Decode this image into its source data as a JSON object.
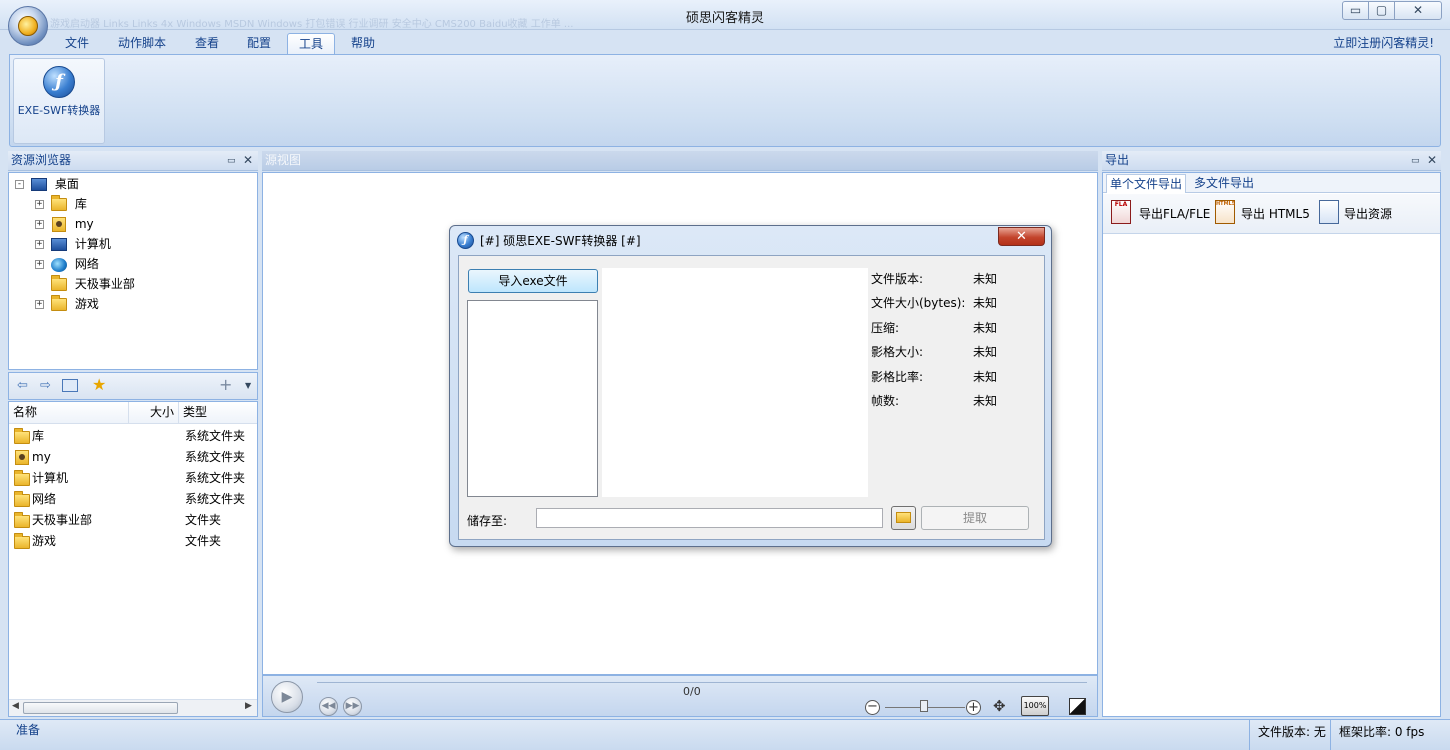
{
  "window": {
    "title": "硕思闪客精灵",
    "quick_access": "游戏启动器  Links  Links 4x  Windows  MSDN  Windows  打包错误  行业调研  安全中心  CMS200  Baidu收藏  工作单  ...",
    "min_label": "▭",
    "max_label": "▢",
    "close_label": "✕"
  },
  "menu": {
    "tabs": [
      {
        "label": "文件"
      },
      {
        "label": "动作脚本"
      },
      {
        "label": "查看"
      },
      {
        "label": "配置"
      },
      {
        "label": "工具",
        "active": true
      },
      {
        "label": "帮助"
      }
    ],
    "register_link": "立即注册闪客精灵!"
  },
  "ribbon": {
    "button_label": "EXE-SWF转换器",
    "button_icon": "flash-icon"
  },
  "resource_browser": {
    "title": "资源浏览器",
    "tree": [
      {
        "label": "桌面",
        "icon": "desktop-icon",
        "expand": "⊟"
      },
      {
        "label": "库",
        "icon": "library-icon",
        "expand": "+"
      },
      {
        "label": "my",
        "icon": "user-folder-icon",
        "expand": "+"
      },
      {
        "label": "计算机",
        "icon": "computer-icon",
        "expand": "+"
      },
      {
        "label": "网络",
        "icon": "network-icon",
        "expand": "+"
      },
      {
        "label": "天极事业部",
        "icon": "folder-icon",
        "expand": ""
      },
      {
        "label": "游戏",
        "icon": "folder-icon",
        "expand": "+"
      }
    ],
    "columns": {
      "name": "名称",
      "size": "大小",
      "type": "类型"
    },
    "files": [
      {
        "name": "库",
        "size": "",
        "type": "系统文件夹"
      },
      {
        "name": "my",
        "size": "",
        "type": "系统文件夹"
      },
      {
        "name": "计算机",
        "size": "",
        "type": "系统文件夹"
      },
      {
        "name": "网络",
        "size": "",
        "type": "系统文件夹"
      },
      {
        "name": "天极事业部",
        "size": "",
        "type": "文件夹"
      },
      {
        "name": "游戏",
        "size": "",
        "type": "文件夹"
      }
    ]
  },
  "source_view": {
    "title": "源视图",
    "progress_text": "0/0"
  },
  "export_panel": {
    "title": "导出",
    "tabs": [
      "单个文件导出",
      "多文件导出"
    ],
    "actions": [
      {
        "label": "导出FLA/FLE",
        "icon": "fla-icon"
      },
      {
        "label": "导出 HTML5",
        "icon": "html5-icon"
      },
      {
        "label": "导出资源",
        "icon": "resources-icon"
      }
    ]
  },
  "dialog": {
    "title": "[#] 硕思EXE-SWF转换器 [#]",
    "import_button": "导入exe文件",
    "info": [
      {
        "label": "文件版本:",
        "value": "未知"
      },
      {
        "label": "文件大小(bytes):",
        "value": "未知"
      },
      {
        "label": "压缩:",
        "value": "未知"
      },
      {
        "label": "影格大小:",
        "value": "未知"
      },
      {
        "label": "影格比率:",
        "value": "未知"
      },
      {
        "label": "帧数:",
        "value": "未知"
      }
    ],
    "save_label": "储存至:",
    "save_value": "",
    "extract_button": "提取"
  },
  "status": {
    "ready": "准备",
    "file_version": "文件版本: 无",
    "frame_rate": "框架比率: 0 fps"
  },
  "colors": {
    "accent": "#15428b",
    "frame": "#d6e3f3",
    "border": "#8db2e3"
  }
}
